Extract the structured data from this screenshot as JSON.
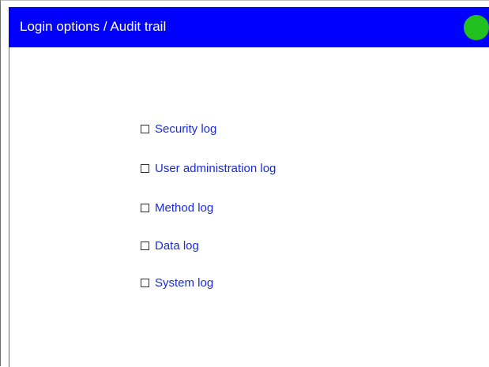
{
  "header": {
    "title": "Login options / Audit trail",
    "status_color": "#22c01e",
    "background_color": "#0000ff"
  },
  "options": [
    {
      "label": "Security log",
      "checked": false
    },
    {
      "label": "User administration log",
      "checked": false
    },
    {
      "label": "Method log",
      "checked": false
    },
    {
      "label": "Data log",
      "checked": false
    },
    {
      "label": "System log",
      "checked": false
    }
  ]
}
